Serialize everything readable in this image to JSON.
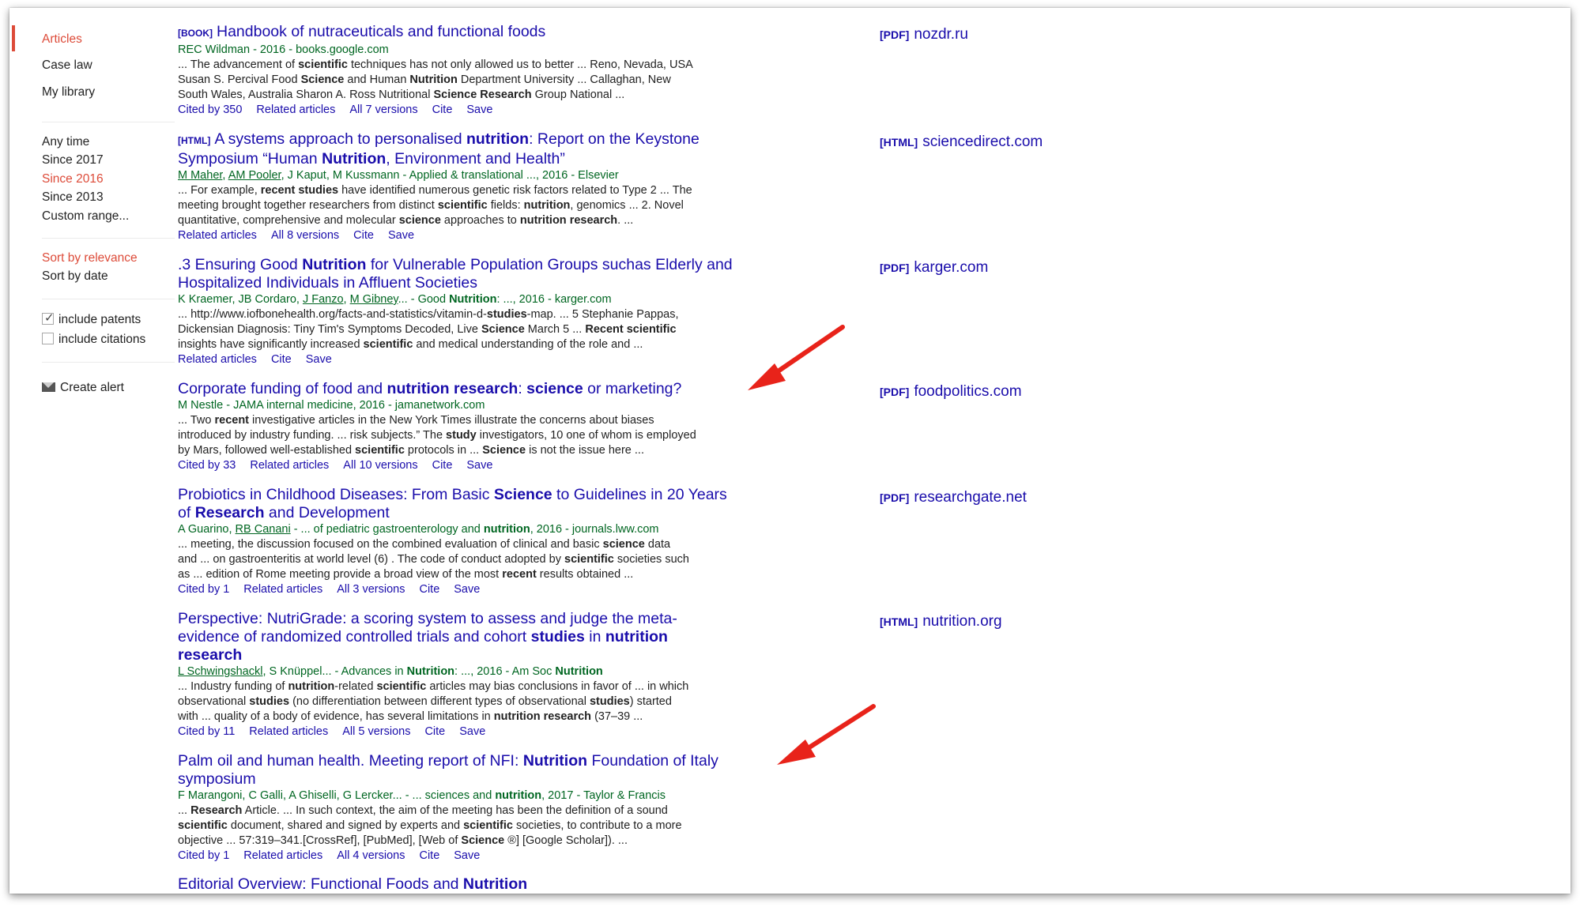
{
  "sidebar": {
    "nav": [
      "Articles",
      "Case law",
      "My library"
    ],
    "time_filters": [
      "Any time",
      "Since 2017",
      "Since 2016",
      "Since 2013",
      "Custom range..."
    ],
    "sort": [
      "Sort by relevance",
      "Sort by date"
    ],
    "include_patents": "include patents",
    "include_citations": "include citations",
    "create_alert": "Create alert"
  },
  "selection": {
    "nav": "Articles",
    "time": "Since 2016",
    "sort": "Sort by relevance"
  },
  "colors": {
    "title_link": "#1a0dab",
    "meta_green": "#006621",
    "selected_red": "#dd4b39",
    "annotation_arrow": "#e8231a"
  },
  "results": [
    {
      "tag": "[BOOK]",
      "title_html": "Handbook of nutraceuticals and functional foods",
      "meta_html": "REC Wildman - 2016 - books.google.com",
      "snippet_html": "... The advancement of <b>scientific</b> techniques has not only allowed us to better ... Reno, Nevada, USA<br>Susan S. Percival Food <b>Science</b> and Human <b>Nutrition</b> Department University ... Callaghan, New<br>South Wales, Australia Sharon A. Ross Nutritional <b>Science Research</b> Group National ...",
      "links": [
        "Cited by 350",
        "Related articles",
        "All 7 versions",
        "Cite",
        "Save"
      ],
      "side_tag": "[PDF]",
      "side_domain": "nozdr.ru"
    },
    {
      "tag": "[HTML]",
      "title_html": "A systems approach to personalised <b>nutrition</b>: Report on the Keystone<br>Symposium “Human <b>Nutrition</b>, Environment and Health”",
      "meta_html": "<u>M Maher</u>, <u>AM Pooler</u>, J Kaput, M Kussmann - Applied &amp; translational ..., 2016 - Elsevier",
      "snippet_html": "... For example, <b>recent studies</b> have identified numerous genetic risk factors related to Type 2 ... The<br>meeting brought together researchers from distinct <b>scientific</b> fields: <b>nutrition</b>, genomics ... 2. Novel<br>quantitative, comprehensive and molecular <b>science</b> approaches to <b>nutrition research</b>. ...",
      "links": [
        "Related articles",
        "All 8 versions",
        "Cite",
        "Save"
      ],
      "side_tag": "[HTML]",
      "side_domain": "sciencedirect.com"
    },
    {
      "tag": "",
      "title_html": ".3 Ensuring Good <b>Nutrition</b> for Vulnerable Population Groups suchas Elderly and<br>Hospitalized Individuals in Affluent Societies",
      "meta_html": "K Kraemer, JB Cordaro, <u>J Fanzo</u>, <u>M Gibney</u>... - Good <b>Nutrition</b>: ..., 2016 - karger.com",
      "snippet_html": "... http://www.iofbonehealth.org/facts-and-statistics/vitamin-d-<b>studies</b>-map. ... 5 Stephanie Pappas,<br>Dickensian Diagnosis: Tiny Tim's Symptoms Decoded, Live <b>Science</b> March 5 ... <b>Recent scientific</b><br>insights have significantly increased <b>scientific</b> and medical understanding of the role and ...",
      "links": [
        "Related articles",
        "Cite",
        "Save"
      ],
      "side_tag": "[PDF]",
      "side_domain": "karger.com"
    },
    {
      "tag": "",
      "title_html": "Corporate funding of food and <b>nutrition research</b>: <b>science</b> or marketing?",
      "meta_html": "M Nestle - JAMA internal medicine, 2016 - jamanetwork.com",
      "snippet_html": "... Two <b>recent</b> investigative articles in the New York Times illustrate the concerns about biases<br>introduced by industry funding. ... risk subjects.” The <b>study</b> investigators, 10 one of whom is employed<br>by Mars, followed well-established <b>scientific</b> protocols in ... <b>Science</b> is not the issue here ...",
      "links": [
        "Cited by 33",
        "Related articles",
        "All 10 versions",
        "Cite",
        "Save"
      ],
      "side_tag": "[PDF]",
      "side_domain": "foodpolitics.com"
    },
    {
      "tag": "",
      "title_html": "Probiotics in Childhood Diseases: From Basic <b>Science</b> to Guidelines in 20 Years<br>of <b>Research</b> and Development",
      "meta_html": "A Guarino, <u>RB Canani</u> - ... of pediatric gastroenterology and <b>nutrition</b>, 2016 - journals.lww.com",
      "snippet_html": "... meeting, the discussion focused on the combined evaluation of clinical and basic <b>science</b> data<br>and ... on gastroenteritis at world level (6) . The code of conduct adopted by <b>scientific</b> societies such<br>as ... edition of Rome meeting provide a broad view of the most <b>recent</b> results obtained ...",
      "links": [
        "Cited by 1",
        "Related articles",
        "All 3 versions",
        "Cite",
        "Save"
      ],
      "side_tag": "[PDF]",
      "side_domain": "researchgate.net"
    },
    {
      "tag": "",
      "title_html": "Perspective: NutriGrade: a scoring system to assess and judge the meta-<br>evidence of randomized controlled trials and cohort <b>studies</b> in <b>nutrition</b><br><b>research</b>",
      "meta_html": "<u>L Schwingshackl</u>, S Knüppel... - Advances in <b>Nutrition</b>: ..., 2016 - Am Soc <b>Nutrition</b>",
      "snippet_html": "... Industry funding of <b>nutrition</b>-related <b>scientific</b> articles may bias conclusions in favor of ... in which<br>observational <b>studies</b> (no differentiation between different types of observational <b>studies</b>) started<br>with ... quality of a body of evidence, has several limitations in <b>nutrition research</b> (37–39 ...",
      "links": [
        "Cited by 11",
        "Related articles",
        "All 5 versions",
        "Cite",
        "Save"
      ],
      "side_tag": "[HTML]",
      "side_domain": "nutrition.org"
    },
    {
      "tag": "",
      "title_html": "Palm oil and human health. Meeting report of NFI: <b>Nutrition</b> Foundation of Italy<br>symposium",
      "meta_html": "F Marangoni, C Galli, A Ghiselli, G Lercker... - ... sciences and <b>nutrition</b>, 2017 - Taylor &amp; Francis",
      "snippet_html": "... <b>Research</b> Article. ... In such context, the aim of the meeting has been the definition of a sound<br><b>scientific</b> document, shared and signed by experts and <b>scientific</b> societies, to contribute to a more<br>objective ... 57:319–341.[CrossRef], [PubMed], [Web of <b>Science</b> ®] [Google Scholar]). ...",
      "links": [
        "Cited by 1",
        "Related articles",
        "All 4 versions",
        "Cite",
        "Save"
      ],
      "side_tag": "",
      "side_domain": ""
    },
    {
      "tag": "",
      "title_html": "Editorial Overview: Functional Foods and <b>Nutrition</b>",
      "meta_html": "",
      "snippet_html": "",
      "links": [],
      "side_tag": "",
      "side_domain": ""
    }
  ]
}
